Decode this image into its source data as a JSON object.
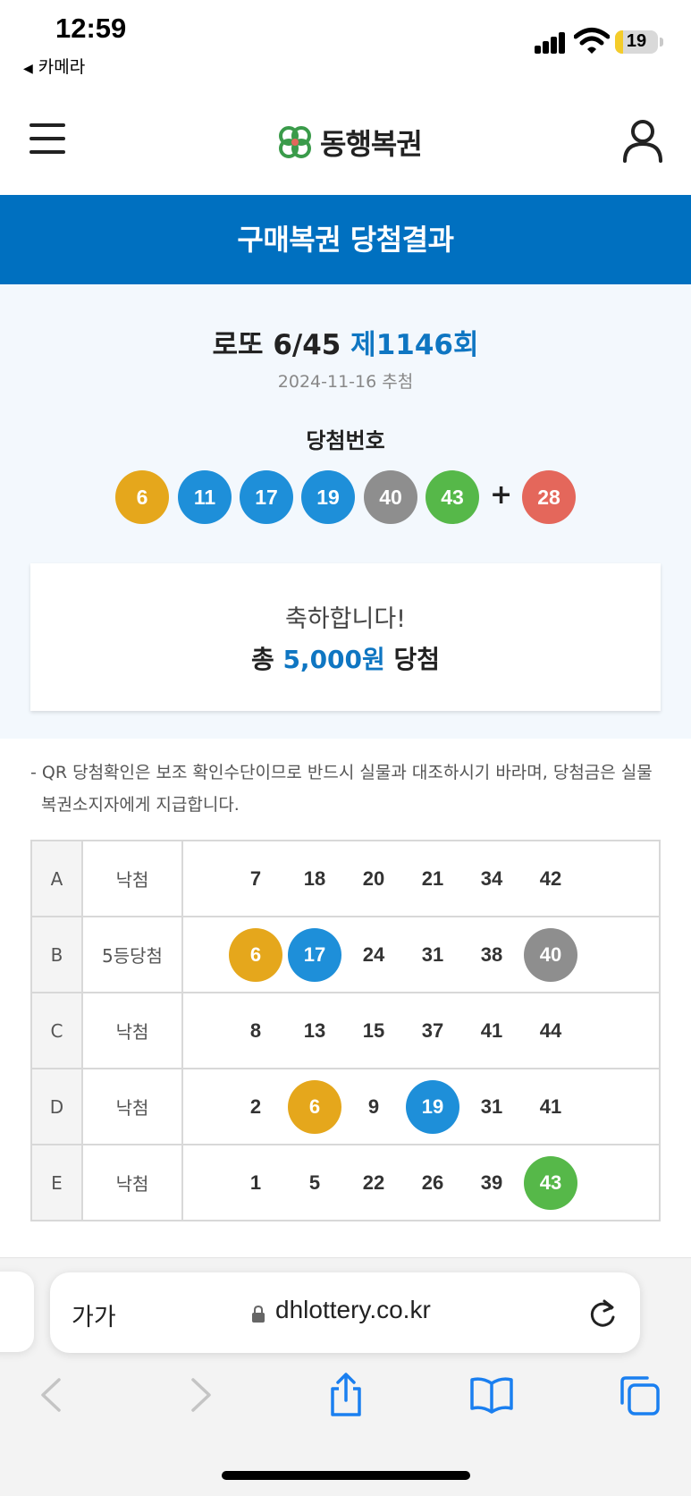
{
  "status_bar": {
    "time": "12:59",
    "back_app": "카메라",
    "battery_level": "19"
  },
  "header": {
    "logo_text": "동행복권"
  },
  "banner": {
    "title": "구매복권 당첨결과"
  },
  "draw": {
    "game": "로또 6/45",
    "round": "제1146회",
    "date": "2024-11-16 추첨",
    "winning_label": "당첨번호",
    "numbers": [
      "6",
      "11",
      "17",
      "19",
      "40",
      "43"
    ],
    "plus": "+",
    "bonus": "28"
  },
  "colors": {
    "yellow": "#e5a71c",
    "blue": "#1e8fd9",
    "red": "#e4675b",
    "gray": "#8e8e8e",
    "green": "#56b849",
    "accent": "#0070c0"
  },
  "result": {
    "congrats": "축하합니다!",
    "prize_prefix": "총",
    "prize_amount": "5,000원",
    "prize_suffix": "당첨"
  },
  "notice": "- QR 당첨확인은 보조 확인수단이므로 반드시 실물과 대조하시기 바라며, 당첨금은 실물 복권소지자에게 지급합니다.",
  "ticket": [
    {
      "game": "A",
      "result": "낙첨",
      "numbers": [
        {
          "n": "7",
          "c": ""
        },
        {
          "n": "18",
          "c": ""
        },
        {
          "n": "20",
          "c": ""
        },
        {
          "n": "21",
          "c": ""
        },
        {
          "n": "34",
          "c": ""
        },
        {
          "n": "42",
          "c": ""
        }
      ]
    },
    {
      "game": "B",
      "result": "5등당첨",
      "numbers": [
        {
          "n": "6",
          "c": "yellow"
        },
        {
          "n": "17",
          "c": "blue"
        },
        {
          "n": "24",
          "c": ""
        },
        {
          "n": "31",
          "c": ""
        },
        {
          "n": "38",
          "c": ""
        },
        {
          "n": "40",
          "c": "gray"
        }
      ]
    },
    {
      "game": "C",
      "result": "낙첨",
      "numbers": [
        {
          "n": "8",
          "c": ""
        },
        {
          "n": "13",
          "c": ""
        },
        {
          "n": "15",
          "c": ""
        },
        {
          "n": "37",
          "c": ""
        },
        {
          "n": "41",
          "c": ""
        },
        {
          "n": "44",
          "c": ""
        }
      ]
    },
    {
      "game": "D",
      "result": "낙첨",
      "numbers": [
        {
          "n": "2",
          "c": ""
        },
        {
          "n": "6",
          "c": "yellow"
        },
        {
          "n": "9",
          "c": ""
        },
        {
          "n": "19",
          "c": "blue"
        },
        {
          "n": "31",
          "c": ""
        },
        {
          "n": "41",
          "c": ""
        }
      ]
    },
    {
      "game": "E",
      "result": "낙첨",
      "numbers": [
        {
          "n": "1",
          "c": ""
        },
        {
          "n": "5",
          "c": ""
        },
        {
          "n": "22",
          "c": ""
        },
        {
          "n": "26",
          "c": ""
        },
        {
          "n": "39",
          "c": ""
        },
        {
          "n": "43",
          "c": "green"
        }
      ]
    }
  ],
  "browser": {
    "text_size_label": "가가",
    "url": "dhlottery.co.kr"
  }
}
